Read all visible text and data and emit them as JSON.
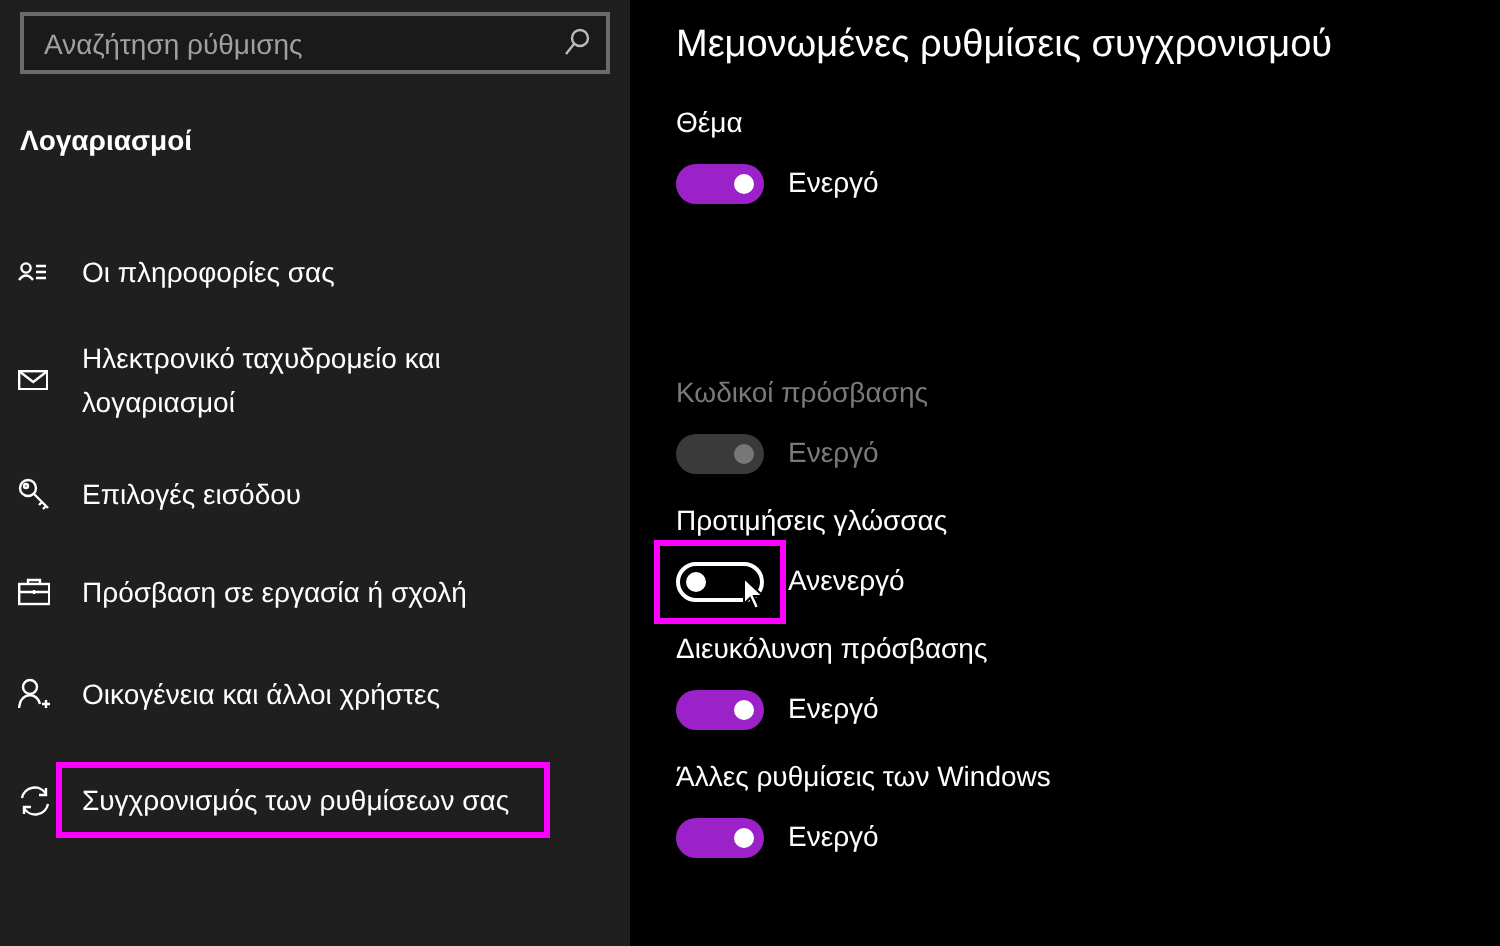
{
  "search": {
    "placeholder": "Αναζήτηση ρύθμισης"
  },
  "sidebar": {
    "heading": "Λογαριασμοί",
    "items": [
      {
        "label": "Οι πληροφορίες σας",
        "highlighted": false
      },
      {
        "label": "Ηλεκτρονικό ταχυδρομείο και λογαριασμοί",
        "highlighted": false
      },
      {
        "label": "Επιλογές εισόδου",
        "highlighted": false
      },
      {
        "label": "Πρόσβαση σε εργασία ή σχολή",
        "highlighted": false
      },
      {
        "label": "Οικογένεια και άλλοι χρήστες",
        "highlighted": false
      },
      {
        "label": "Συγχρονισμός των ρυθμίσεων σας",
        "highlighted": true
      }
    ]
  },
  "main": {
    "title": "Μεμονωμένες ρυθμίσεις συγχρονισμού",
    "settings": [
      {
        "label": "Θέμα",
        "on": true,
        "disabled": false,
        "highlighted": false,
        "state": "Ενεργό"
      },
      {
        "label": "Κωδικοί πρόσβασης",
        "on": true,
        "disabled": true,
        "highlighted": false,
        "state": "Ενεργό"
      },
      {
        "label": "Προτιμήσεις γλώσσας",
        "on": false,
        "disabled": false,
        "highlighted": true,
        "state": "Ανενεργό"
      },
      {
        "label": "Διευκόλυνση πρόσβασης",
        "on": true,
        "disabled": false,
        "highlighted": false,
        "state": "Ενεργό"
      },
      {
        "label": "Άλλες ρυθμίσεις των Windows",
        "on": true,
        "disabled": false,
        "highlighted": false,
        "state": "Ενεργό"
      }
    ]
  }
}
